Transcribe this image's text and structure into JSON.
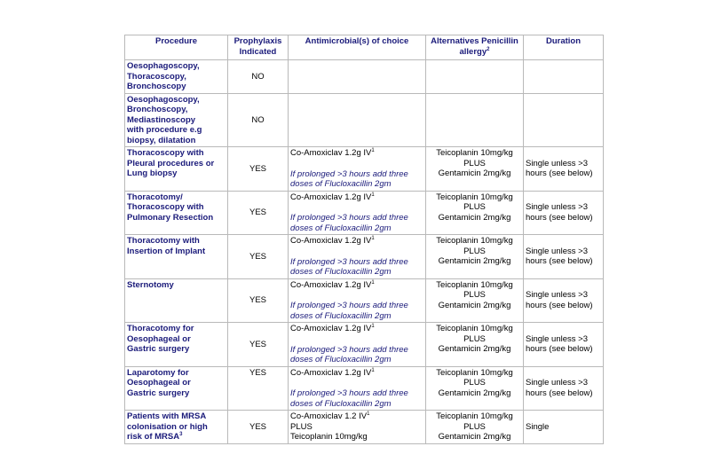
{
  "headers": {
    "procedure": "Procedure",
    "prophylaxis": "Prophylaxis Indicated",
    "antimicrobial": "Antimicrobial(s) of choice",
    "alternatives": "Alternatives Penicillin allergy",
    "alternatives_sup": "2",
    "duration": "Duration"
  },
  "rows": [
    {
      "procedure": [
        "Oesophagoscopy,",
        "Thoracoscopy,",
        "Bronchoscopy"
      ],
      "indicated": "NO"
    },
    {
      "procedure": [
        "Oesophagoscopy,",
        "Bronchoscopy,",
        "Mediastinoscopy",
        "with procedure e.g",
        "biopsy, dilatation"
      ],
      "indicated": "NO"
    },
    {
      "procedure": [
        "Thoracoscopy with",
        "Pleural procedures or",
        "Lung biopsy"
      ],
      "indicated": "YES",
      "antimicrobial": "Co-Amoxiclav 1.2g IV",
      "antimicrobial_sup": "1",
      "note": "If prolonged >3 hours add three doses of Flucloxacillin 2gm",
      "alt": [
        "Teicoplanin 10mg/kg",
        "PLUS",
        "Gentamicin 2mg/kg"
      ],
      "duration": "Single unless >3 hours (see below)"
    },
    {
      "procedure": [
        "Thoracotomy/",
        "Thoracoscopy with",
        "Pulmonary Resection"
      ],
      "indicated": "YES",
      "antimicrobial": "Co-Amoxiclav 1.2g IV",
      "antimicrobial_sup": "1",
      "note": "If prolonged >3 hours add three doses of Flucloxacillin 2gm",
      "alt": [
        "Teicoplanin 10mg/kg",
        "PLUS",
        "Gentamicin 2mg/kg"
      ],
      "duration": "Single unless >3 hours (see below)"
    },
    {
      "procedure": [
        "Thoracotomy with",
        "Insertion of Implant"
      ],
      "indicated": "YES",
      "antimicrobial": "Co-Amoxiclav 1.2g IV",
      "antimicrobial_sup": "1",
      "note": "If prolonged >3 hours add three doses of Flucloxacillin 2gm",
      "alt": [
        "Teicoplanin 10mg/kg",
        "PLUS",
        "Gentamicin 2mg/kg"
      ],
      "duration": "Single unless >3 hours (see below)"
    },
    {
      "procedure": [
        "Sternotomy"
      ],
      "indicated": "YES",
      "antimicrobial": "Co-Amoxiclav 1.2g IV",
      "antimicrobial_sup": "1",
      "note": "If prolonged >3 hours add three doses of Flucloxacillin 2gm",
      "alt": [
        "Teicoplanin 10mg/kg",
        "PLUS",
        "Gentamicin 2mg/kg"
      ],
      "duration": "Single unless >3 hours (see below)"
    },
    {
      "procedure": [
        "Thoracotomy for",
        "Oesophageal or",
        "Gastric surgery"
      ],
      "indicated": "YES",
      "antimicrobial": "Co-Amoxiclav 1.2g IV",
      "antimicrobial_sup": "1",
      "note": "If prolonged >3 hours add three doses of Flucloxacillin 2gm",
      "alt": [
        "Teicoplanin 10mg/kg",
        "PLUS",
        "Gentamicin 2mg/kg"
      ],
      "duration": "Single unless >3 hours (see below)"
    },
    {
      "procedure": [
        "Laparotomy for",
        "Oesophageal or",
        "Gastric surgery"
      ],
      "indicated": "YES",
      "antimicrobial": "Co-Amoxiclav 1.2g IV",
      "antimicrobial_sup": "1",
      "note": "If prolonged >3 hours add three doses of Flucloxacillin 2gm",
      "alt": [
        "Teicoplanin 10mg/kg",
        "PLUS",
        "Gentamicin 2mg/kg"
      ],
      "duration": "Single unless >3 hours (see below)"
    },
    {
      "procedure": [
        "Patients with MRSA",
        "colonisation or high",
        "risk of MRSA"
      ],
      "procedure_sup": "3",
      "indicated": "YES",
      "antimicrobial_lines": [
        "Co-Amoxiclav 1.2 IV",
        "PLUS",
        "Teicoplanin 10mg/kg"
      ],
      "antimicrobial_sup": "1",
      "alt": [
        "Teicoplanin 10mg/kg",
        "PLUS",
        "Gentamicin 2mg/kg"
      ],
      "duration": "Single"
    }
  ]
}
